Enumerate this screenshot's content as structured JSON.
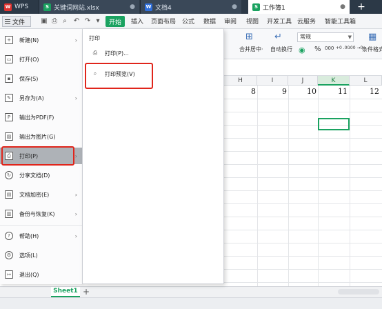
{
  "tabs": {
    "wps": "WPS",
    "workbook1": "关键词网站.xlsx",
    "document": "文档4",
    "active": "工作簿1",
    "new_tab": "+"
  },
  "menu": {
    "file_label": "文件",
    "start_tab": "开始",
    "ribbon_tabs": [
      "插入",
      "页面布局",
      "公式",
      "数据",
      "审阅",
      "视图",
      "开发工具",
      "云服务",
      "智能工具箱"
    ]
  },
  "ribbon": {
    "merge_center": "合并居中·",
    "wrap_text": "自动换行",
    "number_format": "常规",
    "conditional_format": "条件格式",
    "percent": "%",
    "thousands": "000",
    "inc_decimal": "+0 .00",
    "dec_decimal": ".00 →0"
  },
  "file_menu": {
    "items": [
      {
        "label": "新建(N)",
        "icon": "new-file-icon",
        "arrow": true
      },
      {
        "label": "打开(O)",
        "icon": "open-folder-icon",
        "arrow": false
      },
      {
        "label": "保存(S)",
        "icon": "save-icon",
        "arrow": false
      },
      {
        "label": "另存为(A)",
        "icon": "save-as-icon",
        "arrow": true
      },
      {
        "label": "输出为PDF(F)",
        "icon": "pdf-icon",
        "arrow": false
      },
      {
        "label": "输出为图片(G)",
        "icon": "image-export-icon",
        "arrow": false
      },
      {
        "label": "打印(P)",
        "icon": "printer-icon",
        "arrow": true
      },
      {
        "label": "分享文档(D)",
        "icon": "share-icon",
        "arrow": false
      },
      {
        "label": "文档加密(E)",
        "icon": "lock-icon",
        "arrow": true
      },
      {
        "label": "备份与恢复(K)",
        "icon": "backup-icon",
        "arrow": true
      },
      {
        "label": "帮助(H)",
        "icon": "help-icon",
        "arrow": true
      },
      {
        "label": "选项(L)",
        "icon": "gear-icon",
        "arrow": false
      },
      {
        "label": "退出(Q)",
        "icon": "exit-icon",
        "arrow": false
      }
    ]
  },
  "print_submenu": {
    "title": "打印",
    "print_item": "打印(P)...",
    "preview_item": "打印预览(V)"
  },
  "grid": {
    "columns": [
      "H",
      "I",
      "J",
      "K",
      "L"
    ],
    "selected_column": "K",
    "row1_values": [
      "8",
      "9",
      "10",
      "11",
      "12"
    ]
  },
  "sheet": {
    "active_sheet": "Sheet1",
    "add_sheet": "+"
  },
  "colors": {
    "accent_green": "#1aa260",
    "highlight_red": "#e0251b",
    "titlebar": "#2c3947"
  }
}
